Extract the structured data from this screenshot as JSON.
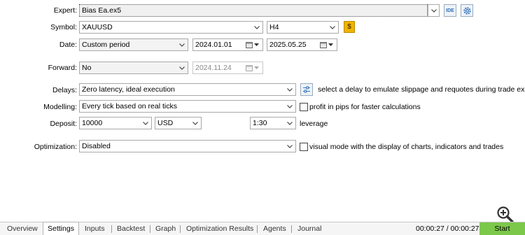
{
  "labels": {
    "expert": "Expert:",
    "symbol": "Symbol:",
    "date": "Date:",
    "forward": "Forward:",
    "delays": "Delays:",
    "modelling": "Modelling:",
    "deposit": "Deposit:",
    "optimization": "Optimization:"
  },
  "expert": {
    "value": "Bias Ea.ex5",
    "ide_label": "IDE"
  },
  "symbol": {
    "value": "XAUUSD",
    "timeframe": "H4"
  },
  "date": {
    "period": "Custom period",
    "from": "2024.01.01",
    "to": "2025.05.25"
  },
  "forward": {
    "value": "No",
    "date": "2024.11.24"
  },
  "delays": {
    "value": "Zero latency, ideal execution",
    "hint": "select a delay to emulate slippage and requotes during trade execution"
  },
  "modelling": {
    "value": "Every tick based on real ticks",
    "pips_label": "profit in pips for faster calculations",
    "pips_checked": false
  },
  "deposit": {
    "amount": "10000",
    "currency": "USD",
    "leverage": "1:30",
    "leverage_label": "leverage"
  },
  "optimization": {
    "value": "Disabled",
    "visual_label": "visual mode with the display of charts, indicators and trades",
    "visual_checked": false
  },
  "tabs": [
    {
      "label": "Overview",
      "active": false
    },
    {
      "label": "Settings",
      "active": true
    },
    {
      "label": "Inputs",
      "active": false
    },
    {
      "label": "Backtest",
      "active": false
    },
    {
      "label": "Graph",
      "active": false
    },
    {
      "label": "Optimization Results",
      "active": false
    },
    {
      "label": "Agents",
      "active": false
    },
    {
      "label": "Journal",
      "active": false
    }
  ],
  "status": {
    "timer": "00:00:27 / 00:00:27",
    "start_label": "Start"
  },
  "colors": {
    "start_button": "#7cc84b",
    "symbol_button": "#f0b400",
    "icon_blue": "#2f6fb7"
  },
  "icons": [
    "chevron-down-icon",
    "calendar-icon",
    "gear-icon",
    "currency-icon",
    "sliders-icon",
    "zoom-in-icon"
  ]
}
